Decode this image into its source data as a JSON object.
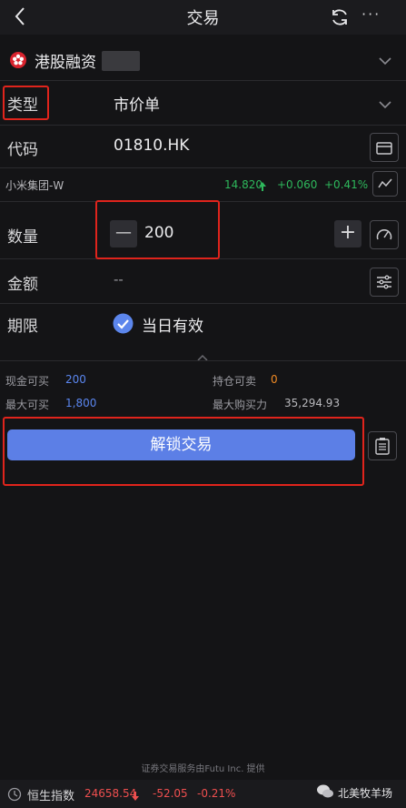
{
  "header": {
    "title": "交易",
    "more": "···"
  },
  "account": {
    "name": "港股融资"
  },
  "order_type": {
    "label": "类型",
    "value": "市价单"
  },
  "code": {
    "label": "代码",
    "value": "01810.HK"
  },
  "stock": {
    "name": "小米集团-W",
    "price": "14.820",
    "change": "+0.060",
    "change_pct": "+0.41%"
  },
  "quantity": {
    "label": "数量",
    "value": "200",
    "minus": "—",
    "plus": "+"
  },
  "amount": {
    "label": "金额",
    "value": "--"
  },
  "validity": {
    "label": "期限",
    "value": "当日有效"
  },
  "stats": {
    "cash_buy_label": "现金可买",
    "cash_buy_value": "200",
    "hold_sell_label": "持仓可卖",
    "hold_sell_value": "0",
    "max_buy_label": "最大可买",
    "max_buy_value": "1,800",
    "max_power_label": "最大购买力",
    "max_power_value": "35,294.93"
  },
  "action": {
    "unlock_label": "解锁交易"
  },
  "footer": {
    "note": "证券交易服务由Futu Inc. 提供",
    "index_name": "恒生指数",
    "index_value": "24658.54",
    "index_change": "-52.05",
    "index_change_pct": "-0.21%",
    "watermark": "北美牧羊场"
  },
  "colors": {
    "accent": "#5c7fe6",
    "up": "#2eb85c",
    "down": "#ef4f4f",
    "highlight": "#e0241c"
  }
}
